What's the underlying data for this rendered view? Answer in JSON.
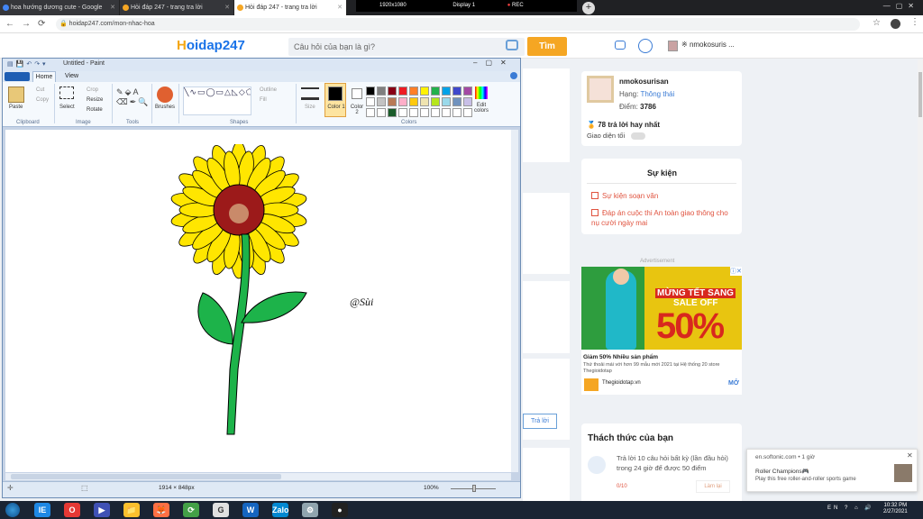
{
  "browser": {
    "tabs": [
      {
        "label": "hoa hướng dương cute - Google",
        "active": false
      },
      {
        "label": "Hỏi đáp 247 - trang tra lời",
        "active": true
      },
      {
        "label": "Hỏi đáp 247 - trang tra lời",
        "active": false
      }
    ],
    "recorder": {
      "resolution": "1920x1080",
      "display": "Display 1",
      "rec": "REC"
    },
    "url": "hoidap247.com/mon-nhac-hoa"
  },
  "site": {
    "logo_prefix": "H",
    "logo_rest": "oidap247",
    "search_placeholder": "Câu hỏi của bạn là gì?",
    "search_button": "Tìm",
    "header_user": "nmokosuris ..."
  },
  "profile": {
    "name": "nmokosurisan",
    "rank_label": "Hạng:",
    "rank_value": "Thông thái",
    "points_label": "Điểm:",
    "points_value": "3786",
    "best_answers": "78 trả lời hay nhất",
    "dark_mode": "Giao diện tối"
  },
  "events": {
    "title": "Sự kiện",
    "items": [
      "Sự kiện soạn văn",
      "Đáp án cuộc thi An toàn giao thông cho nụ cười ngày mai"
    ]
  },
  "ad": {
    "label": "Advertisement",
    "headline1": "MỪNG TẾT SANG",
    "headline2": "SALE OFF",
    "percent": "50%",
    "title": "Giảm 50% Nhiều sản phẩm",
    "desc": "Thứ thoải mái với hơn 99 mẫu mới 2021 tại Hệ thống 20 store Thegioidotap",
    "site": "Thegioidotap.vn",
    "cta": "MỞ"
  },
  "challenge": {
    "title": "Thách thức của bạn",
    "text": "Trả lời 10 câu hỏi bất kỳ (lần đầu hỏi) trong 24 giờ để được 50 điểm",
    "progress": "0/10",
    "button": "Làm lại"
  },
  "middle": {
    "reply_button": "Trả lời"
  },
  "notification": {
    "source": "en.softonic.com • 1 giờ",
    "title": "Roller Champions🎮",
    "body": "Play this free roller-and-roller sports game"
  },
  "paint": {
    "title": "Untitled - Paint",
    "tabs": {
      "home": "Home",
      "view": "View"
    },
    "groups": {
      "clipboard": "Clipboard",
      "image": "Image",
      "tools": "Tools",
      "shapes": "Shapes",
      "colors": "Colors"
    },
    "buttons": {
      "paste": "Paste",
      "cut": "Cut",
      "copy": "Copy",
      "select": "Select",
      "crop": "Crop",
      "resize": "Resize",
      "rotate": "Rotate",
      "brushes": "Brushes",
      "outline": "Outline",
      "fill": "Fill",
      "size": "Size",
      "color1": "Color 1",
      "color2": "Color 2",
      "edit_colors": "Edit colors"
    },
    "status_size": "1914 × 848px",
    "zoom": "100%",
    "signature": "@Sùi",
    "palette": [
      "#000000",
      "#7f7f7f",
      "#880015",
      "#ed1c24",
      "#ff7f27",
      "#fff200",
      "#22b14c",
      "#00a2e8",
      "#3f48cc",
      "#a349a4",
      "#ffffff",
      "#c3c3c3",
      "#b97a57",
      "#ffaec9",
      "#ffc90e",
      "#efe4b0",
      "#b5e61d",
      "#99d9ea",
      "#7092be",
      "#c8bfe7"
    ],
    "flower_colors": {
      "petal": "#ffe600",
      "center_ring": "#9c1a1a",
      "center_disk": "#c98a6a",
      "stem": "#1db34a"
    }
  },
  "taskbar": {
    "apps": [
      "IE",
      "O",
      "▶",
      "📁",
      "🦊",
      "⟳",
      "G",
      "W",
      "Zalo",
      "⚙",
      "●"
    ],
    "tray": "EN ? ⌂ 🔊",
    "time": "10:32 PM",
    "date": "2/27/2021"
  }
}
